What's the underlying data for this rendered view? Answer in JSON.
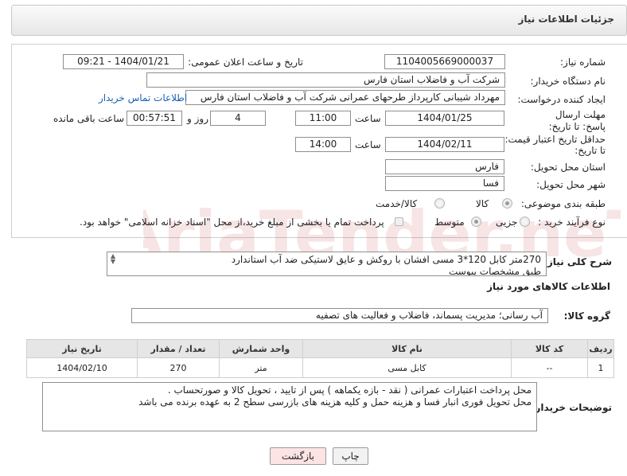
{
  "header": {
    "title": "جزئیات اطلاعات نیاز"
  },
  "form": {
    "need_number_label": "شماره نیاز:",
    "need_number": "1104005669000037",
    "announce_label": "تاریخ و ساعت اعلان عمومی:",
    "announce_value": "1404/01/21 - 09:21",
    "buyer_label": "نام دستگاه خریدار:",
    "buyer_value": "شرکت آب و فاضلاب استان فارس",
    "creator_label": "ایجاد کننده درخواست:",
    "creator_value": "مهرداد شیبانی کارپرداز طرحهای عمرانی  شرکت آب و فاضلاب استان فارس",
    "contact_link": "اطلاعات تماس خریدار",
    "deadline_label": "مهلت ارسال پاسخ: تا تاریخ:",
    "deadline_date": "1404/01/25",
    "time_label": "ساعت",
    "deadline_time": "11:00",
    "days_value": "4",
    "days_label": "روز و",
    "remaining_value": "00:57:51",
    "remaining_label": "ساعت باقی مانده",
    "price_label_1": "حداقل تاریخ اعتبار قیمت:",
    "price_label_2": "تا تاریخ:",
    "price_date": "1404/02/11",
    "price_time": "14:00",
    "province_label": "استان محل تحویل:",
    "province_value": "فارس",
    "city_label": "شهر محل تحویل:",
    "city_value": "فسا",
    "category_label": "طبقه بندی موضوعی:",
    "category_options": [
      "کالا",
      "کالا/خدمت"
    ],
    "process_label": "نوع فرآیند خرید :",
    "process_options": [
      "جزیی",
      "متوسط"
    ],
    "payment_note": "پرداخت تمام یا بخشی از مبلغ خرید،از محل \"اسناد خزانه اسلامی\" خواهد بود."
  },
  "description": {
    "label": "شرح کلی نیاز:",
    "line1": "270متر کابل 120*3 مسی افشان با روکش و عایق لاستیکی ضد آب استاندارد",
    "line2": "طبق مشخصات پیوست"
  },
  "goods": {
    "title": "اطلاعات کالاهای مورد نیاز",
    "group_label": "گروه کالا:",
    "group_value": "آب رسانی؛ مدیریت پسماند، فاضلاب و فعالیت های تصفیه"
  },
  "table": {
    "headers": {
      "row": "ردیف",
      "code": "کد کالا",
      "name": "نام کالا",
      "unit": "واحد شمارش",
      "qty": "تعداد / مقدار",
      "date": "تاریخ نیاز"
    },
    "rows": [
      {
        "row": "1",
        "code": "--",
        "name": "کابل مسی",
        "unit": "متر",
        "qty": "270",
        "date": "1404/02/10"
      }
    ]
  },
  "buyer_notes": {
    "label": "توضیحات خریدار:",
    "line1": "محل پرداخت اعتبارات عمرانی ( نقد - بازه یکماهه ) پس از تایید ، تحویل کالا و صورتحساب .",
    "line2": "محل تحویل فوری انبار فسا و هزینه حمل و کلیه هزینه های بازرسی سطح 2 به عهده برنده می باشد"
  },
  "buttons": {
    "print": "چاپ",
    "back": "بازگشت"
  },
  "watermark_text": "AriaTender.neT",
  "colors": {
    "link": "#1a5fb4",
    "back_button_bg": "#fde4e4",
    "header_bg": "#ececec"
  }
}
